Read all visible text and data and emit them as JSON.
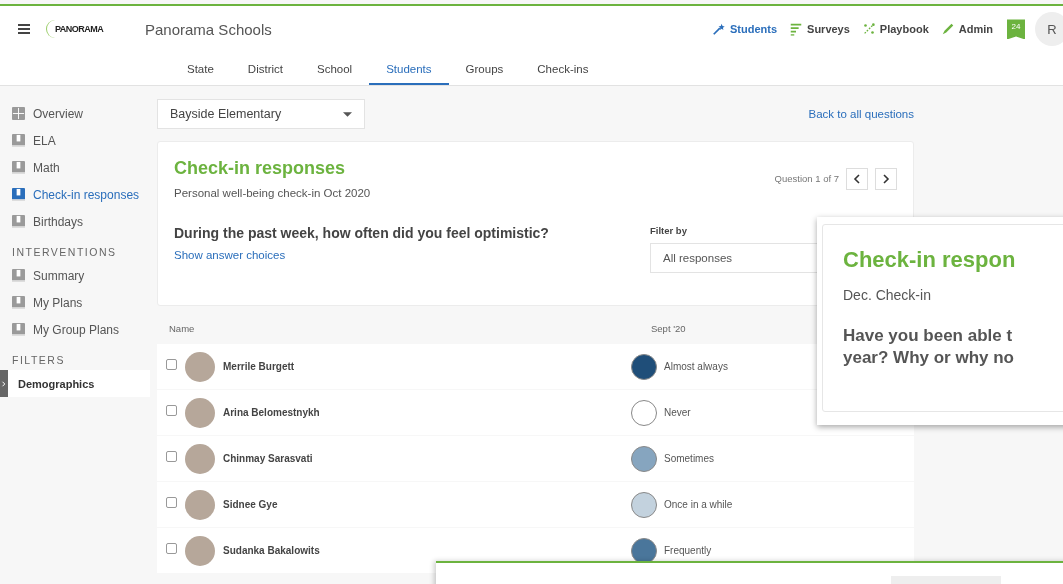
{
  "header": {
    "logo": "PANORAMA",
    "title": "Panorama Schools",
    "nav": [
      {
        "label": "Students",
        "selected": true,
        "kind": "students"
      },
      {
        "label": "Surveys",
        "selected": false,
        "kind": "surveys"
      },
      {
        "label": "Playbook",
        "selected": false,
        "kind": "playbook"
      },
      {
        "label": "Admin",
        "selected": false,
        "kind": "admin"
      }
    ],
    "badge": "24",
    "avatar": "R"
  },
  "tabs": [
    {
      "label": "State",
      "selected": false
    },
    {
      "label": "District",
      "selected": false
    },
    {
      "label": "School",
      "selected": false
    },
    {
      "label": "Students",
      "selected": true
    },
    {
      "label": "Groups",
      "selected": false
    },
    {
      "label": "Check-ins",
      "selected": false
    }
  ],
  "sidebar": {
    "items": [
      {
        "label": "Overview",
        "selected": false,
        "kind": "grid"
      },
      {
        "label": "ELA",
        "selected": false,
        "kind": "book"
      },
      {
        "label": "Math",
        "selected": false,
        "kind": "book"
      },
      {
        "label": "Check-in responses",
        "selected": true,
        "kind": "book"
      },
      {
        "label": "Birthdays",
        "selected": false,
        "kind": "book"
      }
    ],
    "sections": [
      {
        "heading": "INTERVENTIONS",
        "items": [
          {
            "label": "Summary",
            "selected": false,
            "kind": "book"
          },
          {
            "label": "My Plans",
            "selected": false,
            "kind": "book"
          },
          {
            "label": "My Group Plans",
            "selected": false,
            "kind": "book"
          }
        ]
      },
      {
        "heading": "FILTERS",
        "items": [
          {
            "label": "Demographics",
            "selected": false,
            "kind": "filter"
          }
        ]
      }
    ]
  },
  "school_select": {
    "value": "Bayside Elementary"
  },
  "back_link": "Back to all questions",
  "card": {
    "title": "Check-in responses",
    "subtitle": "Personal well-being check-in Oct 2020",
    "pager": "Question 1 of 7",
    "question": "During the past week, how often did you feel optimistic?",
    "link": "Show answer choices",
    "filter_label": "Filter by",
    "filter_value": "All responses"
  },
  "table": {
    "columns": [
      "Name",
      "Sept '20"
    ],
    "rows": [
      {
        "name": "Merrile Burgett",
        "checked": false,
        "response": "Almost always",
        "color": "#1f4e79"
      },
      {
        "name": "Arina Belomestnykh",
        "checked": false,
        "response": "Never",
        "color": "#ffffff"
      },
      {
        "name": "Chinmay Sarasvati",
        "checked": false,
        "response": "Sometimes",
        "color": "#86a5bf"
      },
      {
        "name": "Sidnee Gye",
        "checked": false,
        "response": "Once in a while",
        "color": "#c3d2de"
      },
      {
        "name": "Sudanka Bakalowits",
        "checked": false,
        "response": "Frequently",
        "color": "#4a769b"
      }
    ]
  },
  "overlay_card": {
    "title": "Check-in respon",
    "subtitle": "Dec. Check-in",
    "question_lines": [
      "Have you been able t",
      "year? Why or why no"
    ]
  }
}
